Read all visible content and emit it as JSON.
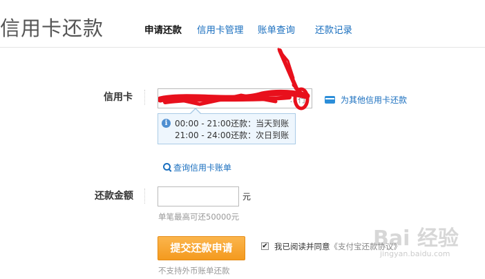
{
  "header": {
    "title": "信用卡还款",
    "tabs": [
      {
        "label": "申请还款",
        "active": true
      },
      {
        "label": "信用卡管理",
        "active": false
      },
      {
        "label": "账单查询",
        "active": false
      },
      {
        "label": "还款记录",
        "active": false
      }
    ]
  },
  "form": {
    "card_label": "信用卡",
    "card_value_visible": "...行",
    "other_card_link": "为其他信用卡还款",
    "tip_line_1": "00:00 - 21:00还款：当天到账",
    "tip_line_2": "21:00 - 24:00还款：次日到账",
    "query_link": "查询信用卡账单",
    "amount_label": "还款金额",
    "amount_value": "",
    "amount_unit": "元",
    "amount_hint": "单笔最高可还50000元",
    "submit_label": "提交还款申请",
    "foreign_hint": "不支持外币账单还款",
    "agree_checked": true,
    "agree_text": "我已阅读并同意",
    "agree_link": "《支付宝还款协议》"
  },
  "watermark": {
    "text": "Bai 经验",
    "sub": "jingyan.baidu.com"
  },
  "colors": {
    "link": "#1a6fbf",
    "accent_button": "#f49a1e",
    "redaction": "#e8101c",
    "tip_bg": "#eef6fd"
  },
  "icons": [
    "info-icon",
    "card-icon",
    "search-icon",
    "checkbox-checked-icon"
  ]
}
